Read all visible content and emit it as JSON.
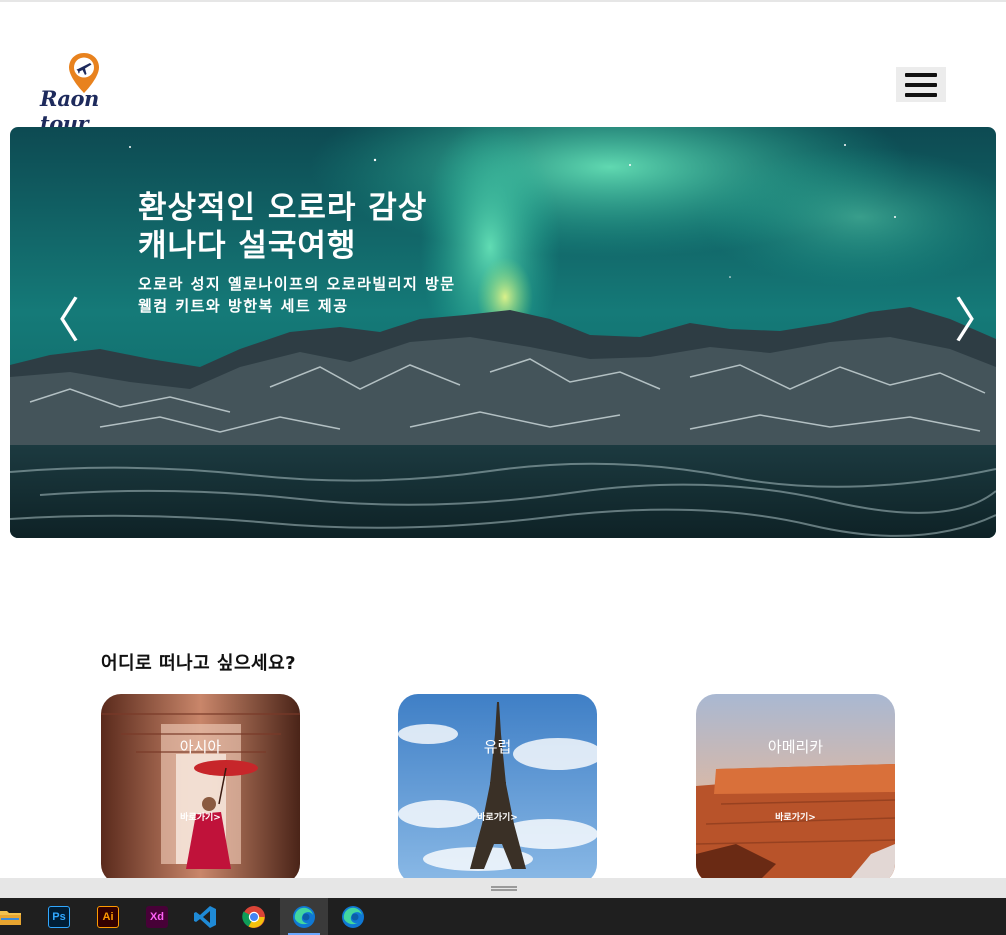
{
  "header": {
    "logo_text": "Raon tour",
    "menu_icon": "hamburger-icon"
  },
  "hero": {
    "title": "환상적인 오로라 감상\n캐나다 설국여행",
    "subtitle": "오로라 성지 옐로나이프의 오로라빌리지 방문\n웰컴 키트와 방한복 세트 제공",
    "prev_glyph": "〈",
    "next_glyph": "〉"
  },
  "destinations": {
    "heading": "어디로 떠나고 싶으세요?",
    "cards": [
      {
        "title": "아시아",
        "link": "바로가기>"
      },
      {
        "title": "유럽",
        "link": "바로가기>"
      },
      {
        "title": "아메리카",
        "link": "바로가기>"
      }
    ]
  },
  "taskbar": {
    "apps": [
      {
        "icon": "file-explorer-icon"
      },
      {
        "icon": "photoshop-icon",
        "label": "Ps"
      },
      {
        "icon": "illustrator-icon",
        "label": "Ai"
      },
      {
        "icon": "xd-icon",
        "label": "Xd"
      },
      {
        "icon": "vscode-icon"
      },
      {
        "icon": "chrome-icon"
      },
      {
        "icon": "edge-icon",
        "active": true
      },
      {
        "icon": "edge-icon"
      }
    ]
  },
  "colors": {
    "logo_pin": "#e8821e",
    "logo_text": "#1d2a5c",
    "aurora": "#1fb59a",
    "taskbar": "#1f1f1f"
  }
}
